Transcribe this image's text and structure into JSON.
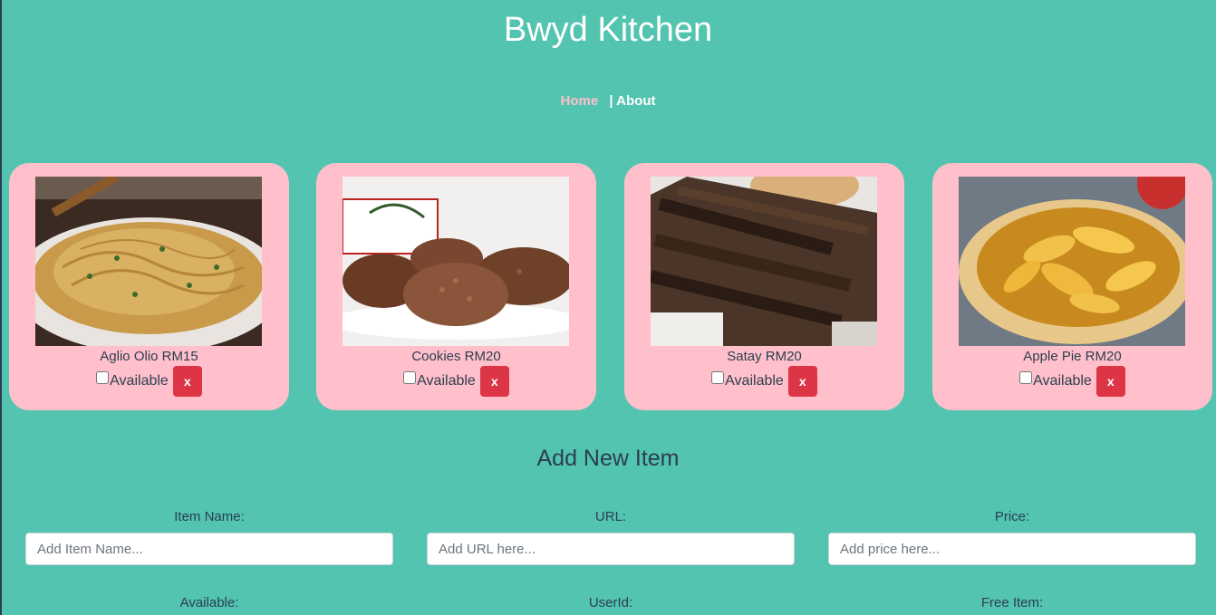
{
  "site": {
    "title": "Bwyd Kitchen"
  },
  "nav": {
    "home": "Home",
    "separator": "|",
    "about": "About"
  },
  "items": [
    {
      "name": "Aglio Olio RM15",
      "available_label": "Available",
      "delete_label": "x",
      "available": false
    },
    {
      "name": "Cookies RM20",
      "available_label": "Available",
      "delete_label": "x",
      "available": false
    },
    {
      "name": "Satay RM20",
      "available_label": "Available",
      "delete_label": "x",
      "available": false
    },
    {
      "name": "Apple Pie RM20",
      "available_label": "Available",
      "delete_label": "x",
      "available": false
    }
  ],
  "form": {
    "title": "Add New Item",
    "item_name": {
      "label": "Item Name:",
      "placeholder": "Add Item Name..."
    },
    "url": {
      "label": "URL:",
      "placeholder": "Add URL here..."
    },
    "price": {
      "label": "Price:",
      "placeholder": "Add price here..."
    },
    "available": {
      "label": "Available:"
    },
    "user_id": {
      "label": "UserId:"
    },
    "free_item": {
      "label": "Free Item:"
    }
  },
  "colors": {
    "background": "#52c4af",
    "card": "#ffc0cb",
    "delete_button": "#dc3545",
    "text": "#2c3e50"
  }
}
